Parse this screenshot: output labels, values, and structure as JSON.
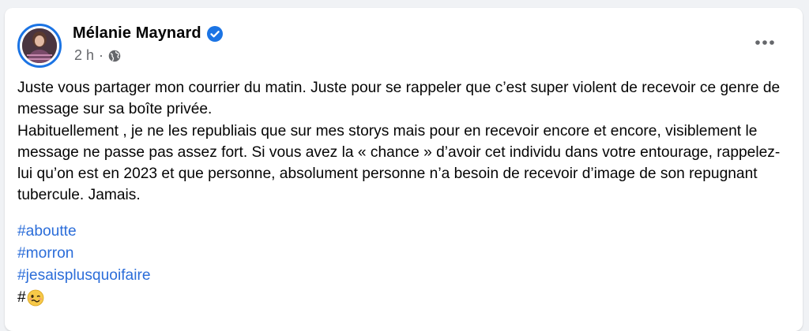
{
  "post": {
    "author": "Mélanie Maynard",
    "time": "2 h",
    "dot": "·",
    "paragraphs": [
      "Juste vous partager mon courrier du matin. Juste pour se rappeler que c’est super violent de recevoir ce genre de message sur sa boîte privée.",
      "Habituellement , je ne les republiais que sur mes storys mais pour en recevoir encore et encore, visiblement le message ne passe pas assez fort. Si vous avez la « chance » d’avoir cet individu dans votre entourage, rappelez-lui qu’on est en 2023 et que personne, absolument personne n’a besoin de recevoir d’image de son repugnant tubercule. Jamais."
    ],
    "hashtags": [
      "#aboutte",
      "#morron",
      "#jesaisplusquoifaire"
    ],
    "last_line_prefix": "#",
    "emoji": "woozy-face-icon"
  },
  "colors": {
    "hashtag": "#2b6dd9",
    "verified": "#1b74e4",
    "meta": "#65676b",
    "text": "#050505"
  }
}
